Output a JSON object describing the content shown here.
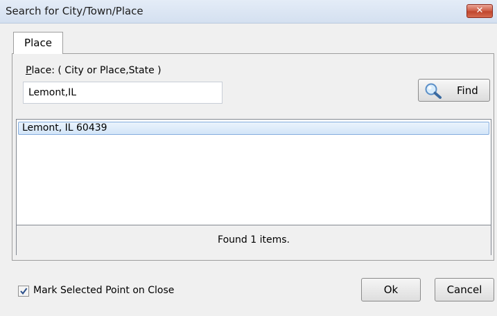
{
  "window": {
    "title": "Search for City/Town/Place",
    "close_icon": "close-icon"
  },
  "tabs": [
    {
      "label": "Place",
      "active": true
    }
  ],
  "place": {
    "label_accel": "P",
    "label_rest": "lace: ( City or Place,State )",
    "value": "Lemont,IL"
  },
  "find_button": {
    "label": "Find",
    "icon": "magnifier-icon"
  },
  "results": {
    "items": [
      {
        "label": "Lemont, IL 60439",
        "selected": true
      }
    ],
    "status": "Found 1 items."
  },
  "options": {
    "mark_selected_label": "Mark Selected Point on Close",
    "mark_selected_checked": true
  },
  "buttons": {
    "ok": "Ok",
    "cancel": "Cancel"
  },
  "colors": {
    "selection_fill": "#d3e5f8",
    "selection_border": "#84acdd",
    "close_button": "#c7503a",
    "checkmark": "#2b4f8a"
  }
}
